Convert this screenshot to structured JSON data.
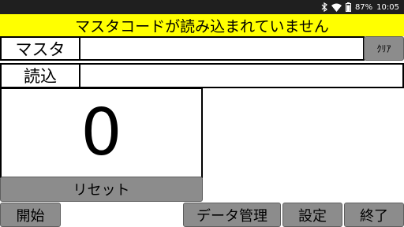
{
  "status": {
    "battery": "87%",
    "time": "10:05"
  },
  "banner": {
    "text": "マスタコードが読み込まれていません",
    "color": "#ffff00"
  },
  "master": {
    "label": "マスタ",
    "value": ""
  },
  "read": {
    "label": "読込",
    "value": ""
  },
  "clear_button": {
    "label": "ｸﾘｱ"
  },
  "counter": {
    "value": "0"
  },
  "reset_button": {
    "label": "リセット"
  },
  "bottom_buttons": {
    "start": "開始",
    "data_management": "データ管理",
    "settings": "設定",
    "exit": "終了"
  },
  "colors": {
    "button_gray": "#8c8c8c",
    "status_bar": "#1f1f1f"
  }
}
